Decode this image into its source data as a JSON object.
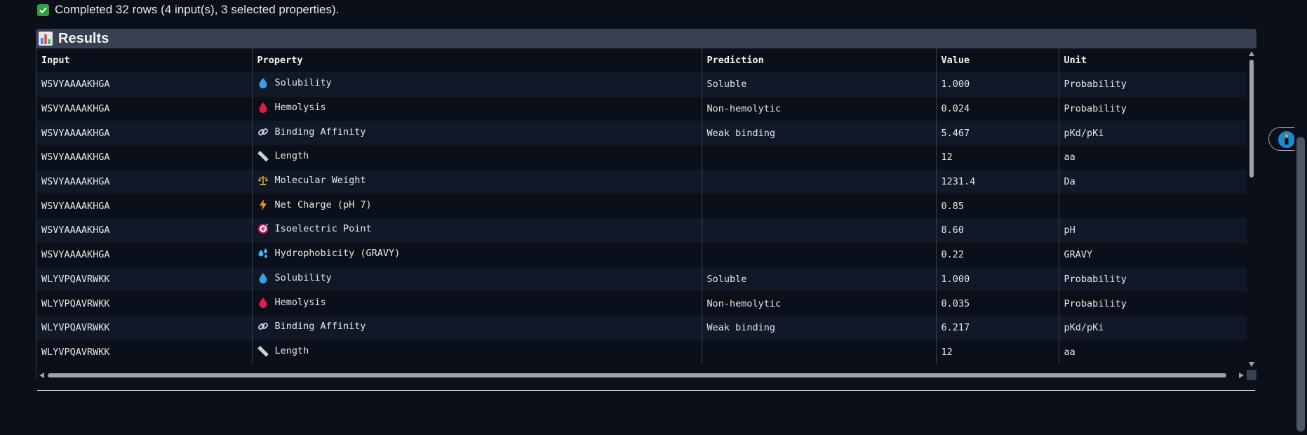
{
  "status": {
    "text": "Completed 32 rows (4 input(s), 3 selected properties).",
    "icon": "check-icon"
  },
  "results": {
    "title": "Results",
    "icon": "bar-chart-icon",
    "columns": [
      "Input",
      "Property",
      "Prediction",
      "Value",
      "Unit"
    ],
    "rows": [
      {
        "input": "WSVYAAAAKHGA",
        "icon": "droplet",
        "property": "Solubility",
        "prediction": "Soluble",
        "value": "1.000",
        "unit": "Probability"
      },
      {
        "input": "WSVYAAAAKHGA",
        "icon": "blood-drop",
        "property": "Hemolysis",
        "prediction": "Non-hemolytic",
        "value": "0.024",
        "unit": "Probability"
      },
      {
        "input": "WSVYAAAAKHGA",
        "icon": "link",
        "property": "Binding Affinity",
        "prediction": "Weak binding",
        "value": "5.467",
        "unit": "pKd/pKi"
      },
      {
        "input": "WSVYAAAAKHGA",
        "icon": "ruler",
        "property": "Length",
        "prediction": "",
        "value": "12",
        "unit": "aa"
      },
      {
        "input": "WSVYAAAAKHGA",
        "icon": "scale",
        "property": "Molecular Weight",
        "prediction": "",
        "value": "1231.4",
        "unit": "Da"
      },
      {
        "input": "WSVYAAAAKHGA",
        "icon": "lightning",
        "property": "Net Charge (pH 7)",
        "prediction": "",
        "value": "0.85",
        "unit": ""
      },
      {
        "input": "WSVYAAAAKHGA",
        "icon": "target",
        "property": "Isoelectric Point",
        "prediction": "",
        "value": "8.60",
        "unit": "pH"
      },
      {
        "input": "WSVYAAAAKHGA",
        "icon": "sweat-drops",
        "property": "Hydrophobicity (GRAVY)",
        "prediction": "",
        "value": "0.22",
        "unit": "GRAVY"
      },
      {
        "input": "WLYVPQAVRWKK",
        "icon": "droplet",
        "property": "Solubility",
        "prediction": "Soluble",
        "value": "1.000",
        "unit": "Probability"
      },
      {
        "input": "WLYVPQAVRWKK",
        "icon": "blood-drop",
        "property": "Hemolysis",
        "prediction": "Non-hemolytic",
        "value": "0.035",
        "unit": "Probability"
      },
      {
        "input": "WLYVPQAVRWKK",
        "icon": "link",
        "property": "Binding Affinity",
        "prediction": "Weak binding",
        "value": "6.217",
        "unit": "pKd/pKi"
      },
      {
        "input": "WLYVPQAVRWKK",
        "icon": "ruler",
        "property": "Length",
        "prediction": "",
        "value": "12",
        "unit": "aa"
      }
    ]
  },
  "colors": {
    "background": "#0b0f19",
    "panel": "#374151",
    "row_alt": "#111827",
    "accent_check": "#2ea043",
    "info_button": "#1e88c8"
  },
  "side_button": {
    "icon": "info-person-icon"
  }
}
